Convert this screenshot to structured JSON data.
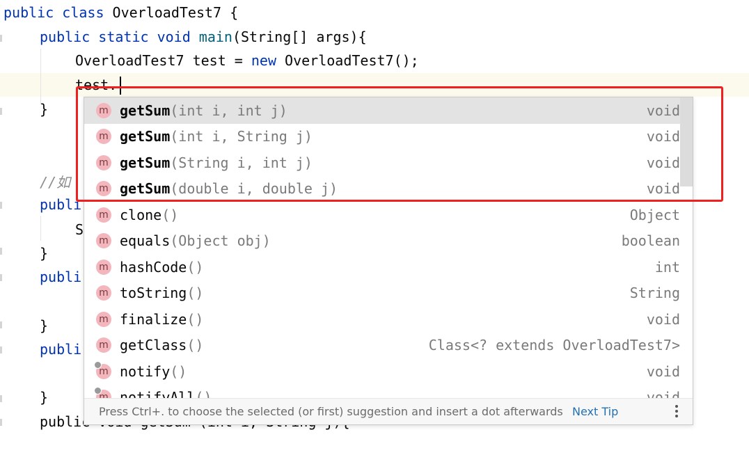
{
  "code": {
    "line1": {
      "kw": "public class ",
      "name": "OverloadTest7",
      "rest": " {"
    },
    "line2": {
      "kw": "public static void ",
      "fn": "main",
      "rest": "(String[] args){"
    },
    "line3": {
      "pre": "OverloadTest7 test = ",
      "kw": "new",
      "post": " OverloadTest7();"
    },
    "line4": "test.",
    "line5": "}",
    "line6": "//如",
    "line7": "publi",
    "line8": "S",
    "line9": "}",
    "line10": "publi",
    "line11": "}",
    "line12": "publi",
    "line13": "}",
    "line14": "public void getSum (int i, String j){"
  },
  "completion": {
    "items": [
      {
        "name": "getSum",
        "params": "(int i, int j)",
        "type": "void",
        "bold": true,
        "selected": true,
        "inherited": false
      },
      {
        "name": "getSum",
        "params": "(int i, String j)",
        "type": "void",
        "bold": true,
        "selected": false,
        "inherited": false
      },
      {
        "name": "getSum",
        "params": "(String i, int j)",
        "type": "void",
        "bold": true,
        "selected": false,
        "inherited": false
      },
      {
        "name": "getSum",
        "params": "(double i, double j)",
        "type": "void",
        "bold": true,
        "selected": false,
        "inherited": false
      },
      {
        "name": "clone",
        "params": "()",
        "type": "Object",
        "bold": false,
        "selected": false,
        "inherited": false
      },
      {
        "name": "equals",
        "params": "(Object obj)",
        "type": "boolean",
        "bold": false,
        "selected": false,
        "inherited": false
      },
      {
        "name": "hashCode",
        "params": "()",
        "type": "int",
        "bold": false,
        "selected": false,
        "inherited": false
      },
      {
        "name": "toString",
        "params": "()",
        "type": "String",
        "bold": false,
        "selected": false,
        "inherited": false
      },
      {
        "name": "finalize",
        "params": "()",
        "type": "void",
        "bold": false,
        "selected": false,
        "inherited": false
      },
      {
        "name": "getClass",
        "params": "()",
        "type": "Class<? extends OverloadTest7>",
        "bold": false,
        "selected": false,
        "inherited": false
      },
      {
        "name": "notify",
        "params": "()",
        "type": "void",
        "bold": false,
        "selected": false,
        "inherited": true
      },
      {
        "name": "notifyAll",
        "params": "()",
        "type": "void",
        "bold": false,
        "selected": false,
        "inherited": true
      }
    ],
    "icon_letter": "m",
    "footer_text": "Press Ctrl+. to choose the selected (or first) suggestion and insert a dot afterwards",
    "next_tip": "Next Tip"
  },
  "colors": {
    "highlight_border": "#f21f1f",
    "keyword": "#0033b3",
    "method_icon": "#f3b6bd",
    "link": "#2470b3"
  }
}
